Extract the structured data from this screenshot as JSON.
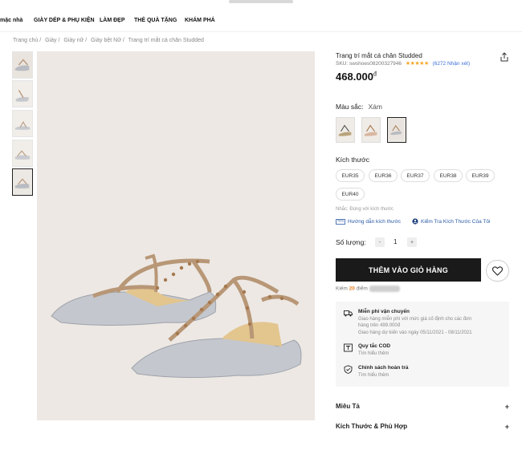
{
  "nav": {
    "items": [
      "mặc nhà",
      "GIÀY DÉP & PHỤ KIỆN",
      "LÀM ĐẸP",
      "THẺ QUÀ TẶNG",
      "KHÁM PHÁ"
    ]
  },
  "breadcrumb": [
    "Trang chủ /",
    "Giày /",
    "Giày nữ /",
    "Giày bệt Nữ /",
    "Trang trí mắt cá chân Studded"
  ],
  "product": {
    "title": "Trang trí mắt cá chân Studded",
    "sku": "SKU: swshoes08200327946",
    "rating_stars": "★★★★★",
    "reviews": "(6272 Nhận xét)",
    "price": "468.000",
    "currency": "đ"
  },
  "color": {
    "label": "Màu sắc:",
    "value": "Xám"
  },
  "size": {
    "label": "Kích thước",
    "options": [
      "EUR35",
      "EUR36",
      "EUR37",
      "EUR38",
      "EUR39",
      "EUR40"
    ],
    "note": "Nhắc: Đúng với kích thước",
    "guide_link": "Hướng dẫn kích thước",
    "check_link": "Kiểm Tra Kích Thước Của Tôi"
  },
  "quantity": {
    "label": "Số lượng:",
    "minus": "-",
    "value": "1",
    "plus": "+"
  },
  "cart": {
    "add_label": "THÊM VÀO GIỎ HÀNG"
  },
  "points": {
    "prefix": "Kiếm",
    "amount": "20",
    "suffix": "điểm"
  },
  "info": {
    "shipping_title": "Miễn phí vận chuyển",
    "shipping_line1": "Giao hàng miễn phí với mức giá cố định cho các đơn",
    "shipping_line2": "hàng trên 499.000đ",
    "shipping_line3": "Giao hàng dự kiến vào ngày 05/11/2021 - 08/11/2021",
    "cod_title": "Quy tắc COD",
    "cod_sub": "Tìm hiểu thêm",
    "return_title": "Chính sách hoàn trả",
    "return_sub": "Tìm hiểu thêm"
  },
  "accordions": {
    "description": "Miêu Tả",
    "fit": "Kích Thước & Phù Hợp",
    "plus": "+"
  },
  "colors": {
    "accent_orange": "#e67e22",
    "link_blue": "#2a5aa8",
    "star": "#f5a623",
    "button": "#1a1a1a"
  }
}
